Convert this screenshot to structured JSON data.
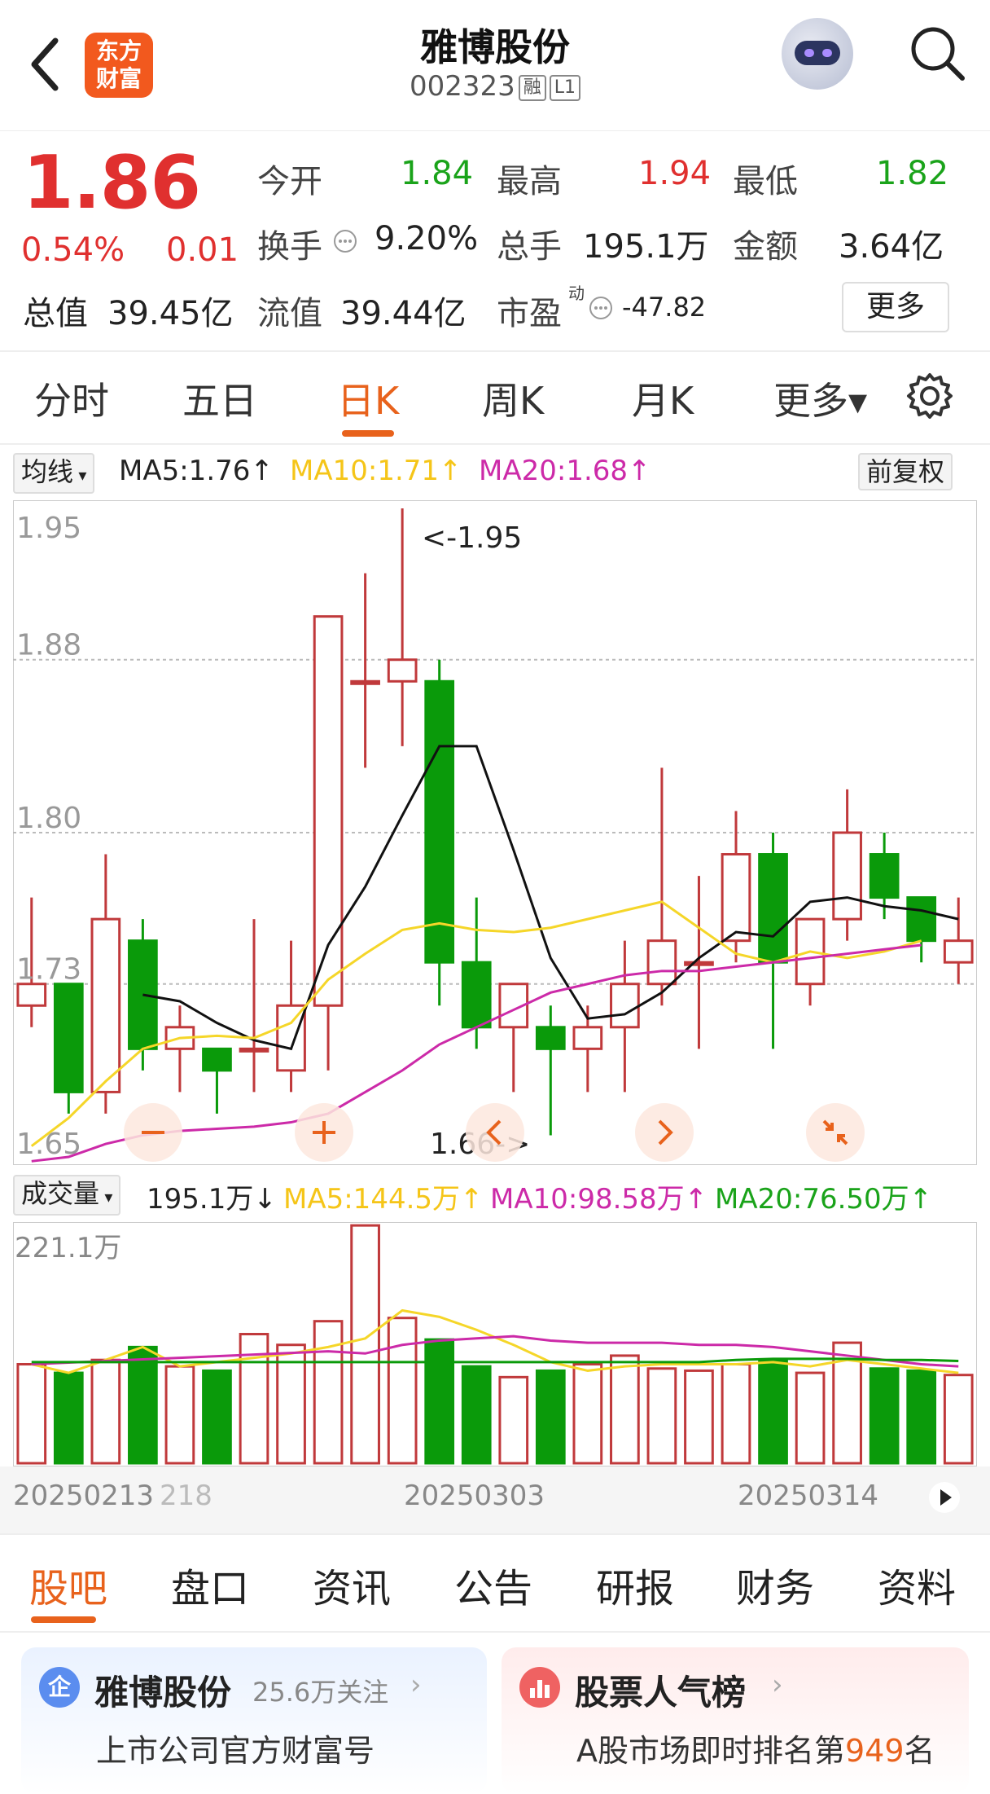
{
  "header": {
    "logo_line1": "东方",
    "logo_line2": "财富",
    "title": "雅博股份",
    "code": "002323",
    "tag1": "融",
    "tag2": "L1"
  },
  "quote": {
    "price": "1.86",
    "pct": "0.54%",
    "change": "0.01",
    "open_label": "今开",
    "open": "1.84",
    "high_label": "最高",
    "high": "1.94",
    "low_label": "最低",
    "low": "1.82",
    "turnover_label": "换手",
    "turnover": "9.20%",
    "volume_label": "总手",
    "volume": "195.1万",
    "amount_label": "金额",
    "amount": "3.64亿",
    "mktcap_label": "总值",
    "mktcap": "39.45亿",
    "float_label": "流值",
    "float": "39.44亿",
    "pe_label": "市盈",
    "pe_sup": "动",
    "pe": "-47.82",
    "more": "更多"
  },
  "tabs": [
    "分时",
    "五日",
    "日K",
    "周K",
    "月K",
    "更多▾"
  ],
  "kline": {
    "indicator": "均线",
    "ma5": "MA5:1.76↑",
    "ma10": "MA10:1.71↑",
    "ma20": "MA20:1.68↑",
    "adjust": "前复权",
    "yticks": [
      "1.95",
      "1.88",
      "1.80",
      "1.73",
      "1.65"
    ],
    "max_label": "<-1.95",
    "min_label": "1.66->"
  },
  "volume": {
    "indicator": "成交量",
    "value": "195.1万↓",
    "ma5": "MA5:144.5万↑",
    "ma10": "MA10:98.58万↑",
    "ma20": "MA20:76.50万↑",
    "top_label": "221.1万"
  },
  "dates": [
    "20250213",
    "218",
    "20250303",
    "20250314"
  ],
  "colors": {
    "up": "#c0393b",
    "down": "#0a9a0a",
    "ma5": "#111111",
    "ma10": "#f5d629",
    "ma20": "#cc2aa8",
    "accent": "#e8621c"
  },
  "chart_data": {
    "type": "candlestick",
    "ylim": [
      1.65,
      1.95
    ],
    "candles": [
      {
        "o": 1.72,
        "c": 1.73,
        "h": 1.77,
        "l": 1.71
      },
      {
        "o": 1.73,
        "c": 1.68,
        "h": 1.73,
        "l": 1.67
      },
      {
        "o": 1.68,
        "c": 1.76,
        "h": 1.79,
        "l": 1.67
      },
      {
        "o": 1.75,
        "c": 1.7,
        "h": 1.76,
        "l": 1.69
      },
      {
        "o": 1.7,
        "c": 1.71,
        "h": 1.72,
        "l": 1.68
      },
      {
        "o": 1.7,
        "c": 1.69,
        "h": 1.7,
        "l": 1.67
      },
      {
        "o": 1.7,
        "c": 1.7,
        "h": 1.76,
        "l": 1.68
      },
      {
        "o": 1.69,
        "c": 1.72,
        "h": 1.75,
        "l": 1.68
      },
      {
        "o": 1.72,
        "c": 1.9,
        "h": 1.9,
        "l": 1.69
      },
      {
        "o": 1.87,
        "c": 1.87,
        "h": 1.92,
        "l": 1.83
      },
      {
        "o": 1.87,
        "c": 1.88,
        "h": 1.95,
        "l": 1.84
      },
      {
        "o": 1.87,
        "c": 1.74,
        "h": 1.88,
        "l": 1.72
      },
      {
        "o": 1.74,
        "c": 1.71,
        "h": 1.77,
        "l": 1.7
      },
      {
        "o": 1.71,
        "c": 1.73,
        "h": 1.73,
        "l": 1.68
      },
      {
        "o": 1.71,
        "c": 1.7,
        "h": 1.72,
        "l": 1.66
      },
      {
        "o": 1.7,
        "c": 1.71,
        "h": 1.72,
        "l": 1.68
      },
      {
        "o": 1.71,
        "c": 1.73,
        "h": 1.75,
        "l": 1.68
      },
      {
        "o": 1.73,
        "c": 1.75,
        "h": 1.83,
        "l": 1.72
      },
      {
        "o": 1.74,
        "c": 1.74,
        "h": 1.78,
        "l": 1.7
      },
      {
        "o": 1.75,
        "c": 1.79,
        "h": 1.81,
        "l": 1.74
      },
      {
        "o": 1.79,
        "c": 1.74,
        "h": 1.8,
        "l": 1.7
      },
      {
        "o": 1.73,
        "c": 1.76,
        "h": 1.76,
        "l": 1.72
      },
      {
        "o": 1.76,
        "c": 1.8,
        "h": 1.82,
        "l": 1.75
      },
      {
        "o": 1.79,
        "c": 1.77,
        "h": 1.8,
        "l": 1.76
      },
      {
        "o": 1.77,
        "c": 1.75,
        "h": 1.77,
        "l": 1.74
      },
      {
        "o": 1.74,
        "c": 1.75,
        "h": 1.77,
        "l": 1.73
      }
    ],
    "ma5": [
      null,
      null,
      null,
      1.725,
      1.722,
      1.712,
      1.704,
      1.7,
      1.748,
      1.775,
      1.808,
      1.84,
      1.84,
      1.792,
      1.742,
      1.714,
      1.716,
      1.726,
      1.742,
      1.754,
      1.752,
      1.768,
      1.77,
      1.766,
      1.764,
      1.76
    ],
    "ma10": [
      1.655,
      1.668,
      1.685,
      1.7,
      1.705,
      1.706,
      1.705,
      1.712,
      1.732,
      1.744,
      1.755,
      1.758,
      1.755,
      1.754,
      1.756,
      1.76,
      1.764,
      1.768,
      1.756,
      1.744,
      1.74,
      1.745,
      1.742,
      1.745,
      1.75,
      1.71
    ],
    "ma20": [
      1.648,
      1.65,
      1.656,
      1.66,
      1.662,
      1.663,
      1.664,
      1.666,
      1.67,
      1.68,
      1.69,
      1.702,
      1.71,
      1.718,
      1.726,
      1.73,
      1.734,
      1.736,
      1.736,
      1.738,
      1.74,
      1.742,
      1.744,
      1.746,
      1.748,
      1.68
    ],
    "volume": [
      92,
      84,
      96,
      108,
      90,
      86,
      120,
      110,
      132,
      221,
      135,
      115,
      90,
      80,
      86,
      92,
      100,
      88,
      86,
      92,
      96,
      84,
      112,
      88,
      86,
      82
    ],
    "vol_ma5": [
      null,
      null,
      null,
      null,
      90,
      94,
      98,
      102,
      108,
      116,
      142,
      136,
      124,
      110,
      94,
      86,
      90,
      92,
      92,
      92,
      94,
      90,
      96,
      92,
      88,
      84
    ],
    "vol_ma10": [
      null,
      null,
      null,
      null,
      null,
      null,
      null,
      null,
      null,
      102,
      110,
      114,
      116,
      118,
      114,
      112,
      112,
      112,
      110,
      110,
      108,
      104,
      100,
      96,
      92,
      90
    ],
    "vol_ma20": [
      null,
      null,
      null,
      null,
      null,
      null,
      null,
      null,
      null,
      null,
      null,
      null,
      null,
      null,
      null,
      null,
      null,
      null,
      null,
      96,
      97,
      97,
      97,
      96,
      96,
      95
    ]
  },
  "bottom_tabs": [
    "股吧",
    "盘口",
    "资讯",
    "公告",
    "研报",
    "财务",
    "资料"
  ],
  "cards": {
    "c1_title": "雅博股份",
    "c1_follow": "25.6万关注",
    "c1_sub": "上市公司官方财富号",
    "c1_icon": "企",
    "c2_title": "股票人气榜",
    "c2_sub_prefix": "A股市场即时排名第",
    "c2_rank": "949",
    "c2_sub_suffix": "名"
  }
}
